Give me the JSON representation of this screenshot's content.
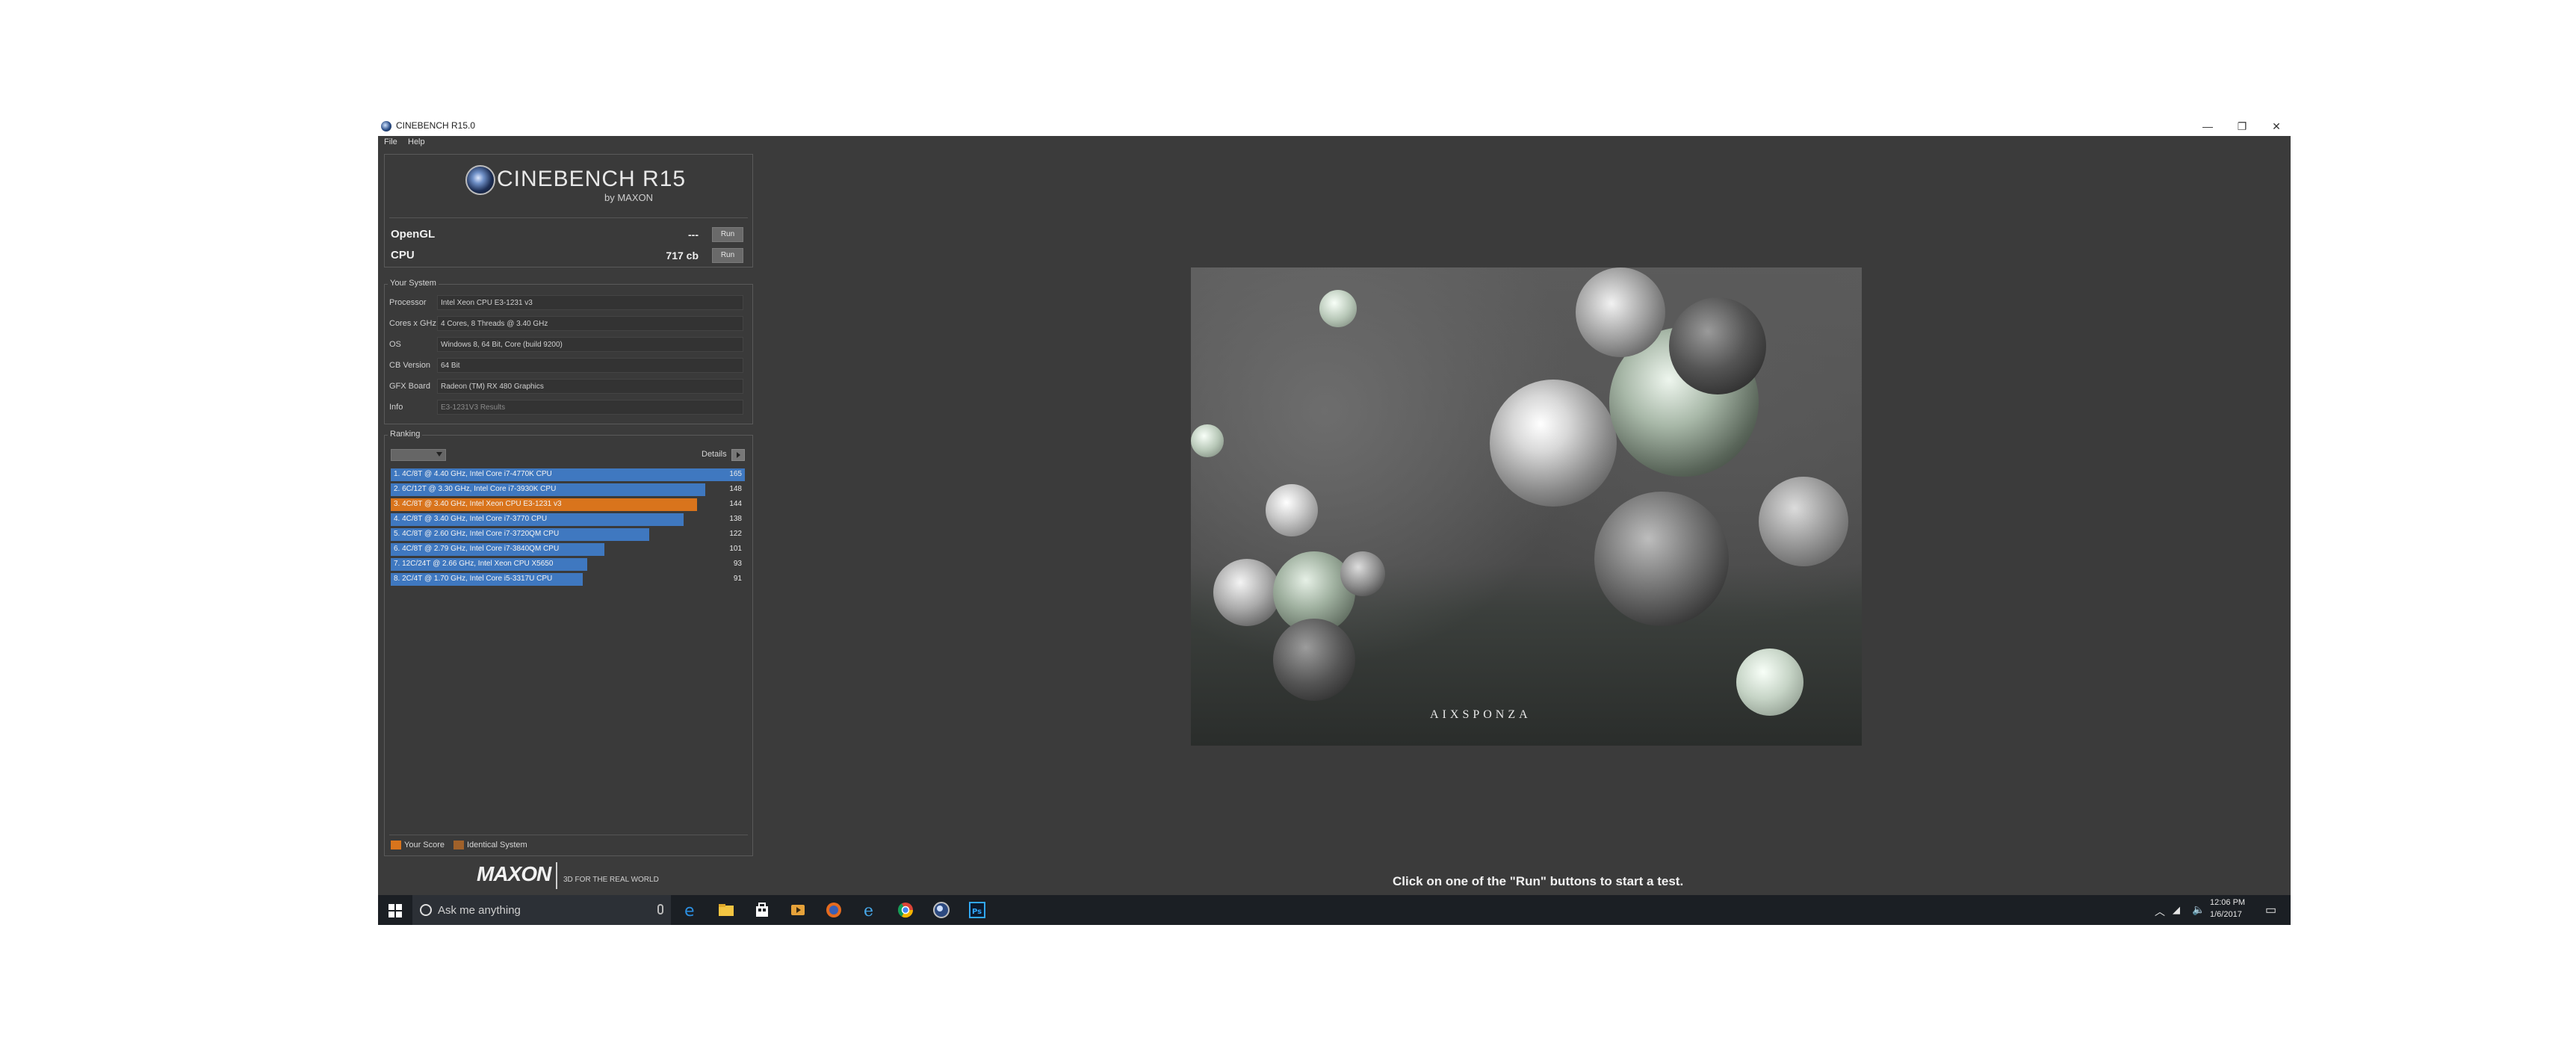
{
  "window": {
    "title": "CINEBENCH R15.0",
    "controls": {
      "minimize": "—",
      "maximize": "❐",
      "close": "✕"
    }
  },
  "menu": [
    "File",
    "Help"
  ],
  "logo": {
    "name": "CINEBENCH R15",
    "sub": "by MAXON"
  },
  "benchmarks": [
    {
      "label": "OpenGL",
      "score": "---",
      "button": "Run"
    },
    {
      "label": "CPU",
      "score": "717 cb",
      "button": "Run"
    }
  ],
  "system": {
    "title": "Your System",
    "rows": [
      {
        "label": "Processor",
        "value": "Intel Xeon CPU E3-1231 v3"
      },
      {
        "label": "Cores x GHz",
        "value": "4 Cores, 8 Threads @ 3.40 GHz"
      },
      {
        "label": "OS",
        "value": "Windows 8, 64 Bit, Core (build 9200)"
      },
      {
        "label": "CB Version",
        "value": "64 Bit"
      },
      {
        "label": "GFX Board",
        "value": "Radeon (TM) RX 480 Graphics"
      },
      {
        "label": "Info",
        "value": "E3-1231V3 Results"
      }
    ]
  },
  "ranking": {
    "title": "Ranking",
    "details_label": "Details",
    "max_score": 165,
    "entries": [
      {
        "label": "1. 4C/8T @ 4.40 GHz, Intel Core i7-4770K CPU",
        "score": 165,
        "highlight": false
      },
      {
        "label": "2. 6C/12T @ 3.30 GHz,  Intel Core i7-3930K CPU",
        "score": 148,
        "highlight": false
      },
      {
        "label": "3. 4C/8T @ 3.40 GHz, Intel Xeon CPU E3-1231 v3",
        "score": 144,
        "highlight": true
      },
      {
        "label": "4. 4C/8T @ 3.40 GHz,  Intel Core i7-3770 CPU",
        "score": 138,
        "highlight": false
      },
      {
        "label": "5. 4C/8T @ 2.60 GHz, Intel Core i7-3720QM CPU",
        "score": 122,
        "highlight": false
      },
      {
        "label": "6. 4C/8T @ 2.79 GHz,  Intel Core i7-3840QM CPU",
        "score": 101,
        "highlight": false
      },
      {
        "label": "7. 12C/24T @ 2.66 GHz, Intel Xeon CPU X5650",
        "score": 93,
        "highlight": false
      },
      {
        "label": "8. 2C/4T @ 1.70 GHz,  Intel Core i5-3317U CPU",
        "score": 91,
        "highlight": false
      }
    ],
    "legend": [
      {
        "label": "Your Score",
        "color": "#d9741c"
      },
      {
        "label": "Identical System",
        "color": "#a0612a"
      }
    ],
    "colors": {
      "bar": "#3f78c0",
      "highlight": "#d9741c"
    }
  },
  "footer": {
    "brand": "MAXON",
    "tagline": "3D FOR THE REAL WORLD"
  },
  "render": {
    "watermark": "AIXSPONZA"
  },
  "status": "Click on one of the \"Run\" buttons to start a test.",
  "taskbar": {
    "search_placeholder": "Ask me anything",
    "apps": [
      "edge-icon",
      "file-explorer-icon",
      "store-icon",
      "media-icon",
      "firefox-icon",
      "ie-icon",
      "chrome-icon",
      "cinebench-icon",
      "photoshop-icon"
    ],
    "clock_time": "12:06 PM",
    "clock_date": "1/6/2017"
  }
}
